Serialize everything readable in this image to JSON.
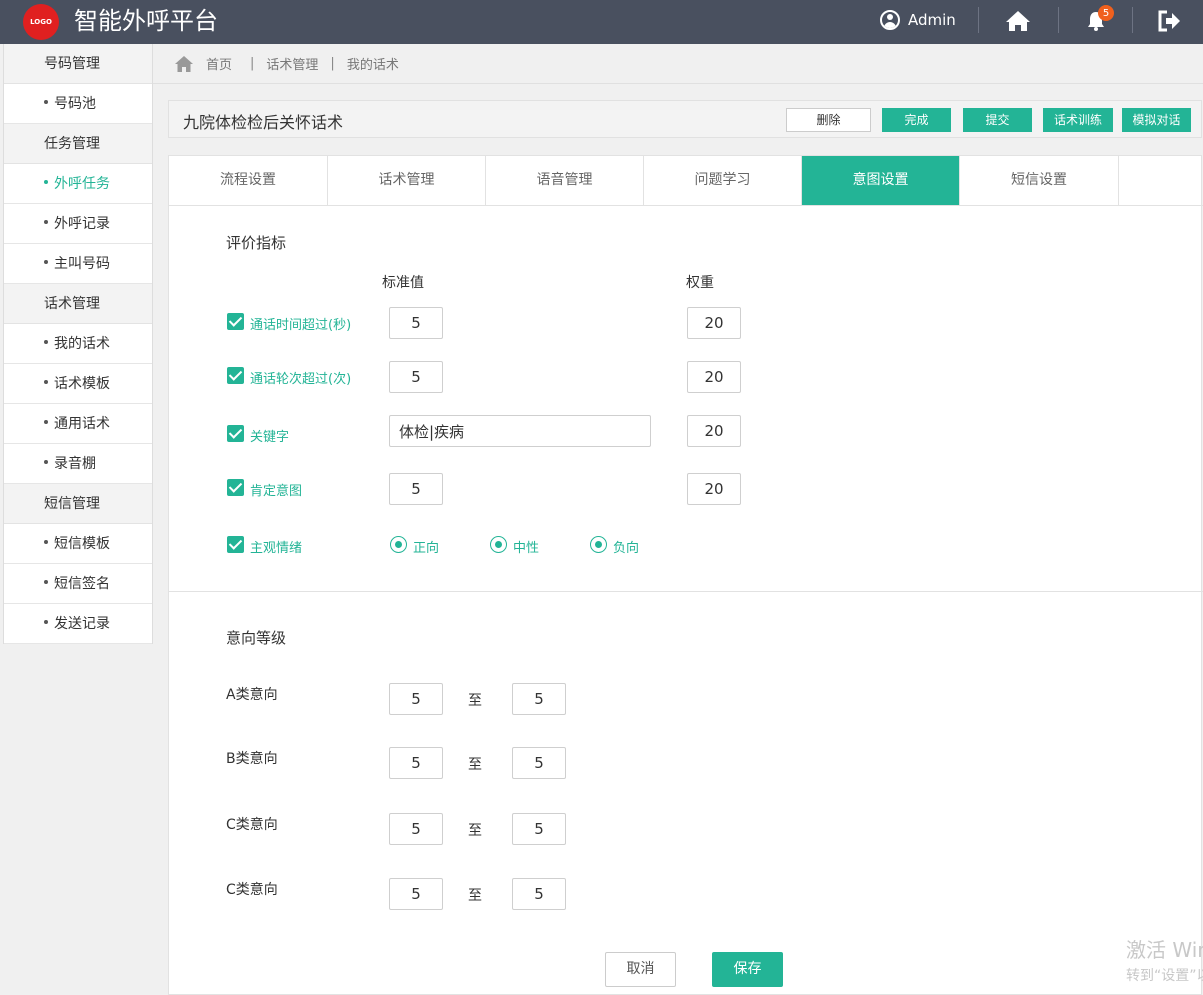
{
  "header": {
    "logo_text": "LOGO",
    "app_title": "智能外呼平台",
    "user_name": "Admin",
    "notification_count": "5"
  },
  "sidebar": {
    "groups": [
      {
        "label": "号码管理",
        "items": [
          {
            "label": "号码池"
          }
        ]
      },
      {
        "label": "任务管理",
        "items": [
          {
            "label": "外呼任务",
            "active": true
          },
          {
            "label": "外呼记录"
          },
          {
            "label": "主叫号码"
          }
        ]
      },
      {
        "label": "话术管理",
        "items": [
          {
            "label": "我的话术"
          },
          {
            "label": "话术模板"
          },
          {
            "label": "通用话术"
          },
          {
            "label": "录音棚"
          }
        ]
      },
      {
        "label": "短信管理",
        "items": [
          {
            "label": "短信模板"
          },
          {
            "label": "短信签名"
          },
          {
            "label": "发送记录"
          }
        ]
      }
    ]
  },
  "breadcrumb": {
    "home": "首页",
    "level1": "话术管理",
    "level2": "我的话术"
  },
  "titlebar": {
    "title": "九院体检检后关怀话术",
    "buttons": [
      "删除",
      "完成",
      "提交",
      "话术训练",
      "模拟对话"
    ]
  },
  "tabs": [
    "流程设置",
    "话术管理",
    "语音管理",
    "问题学习",
    "意图设置",
    "短信设置"
  ],
  "active_tab": "意图设置",
  "evaluation": {
    "title": "评价指标",
    "col_standard": "标准值",
    "col_weight": "权重",
    "rows": [
      {
        "label": "通话时间超过(秒)",
        "checked": true,
        "standard": "5",
        "weight": "20"
      },
      {
        "label": "通话轮次超过(次)",
        "checked": true,
        "standard": "5",
        "weight": "20"
      },
      {
        "label": "关键字",
        "checked": true,
        "standard": "体检|疾病",
        "weight": "20"
      },
      {
        "label": "肯定意图",
        "checked": true,
        "standard": "5",
        "weight": "20"
      }
    ],
    "emotion": {
      "label": "主观情绪",
      "checked": true,
      "options": [
        "正向",
        "中性",
        "负向"
      ]
    }
  },
  "intent_level": {
    "title": "意向等级",
    "to_label": "至",
    "rows": [
      {
        "label": "A类意向",
        "from": "5",
        "to": "5"
      },
      {
        "label": "B类意向",
        "from": "5",
        "to": "5"
      },
      {
        "label": "C类意向",
        "from": "5",
        "to": "5"
      },
      {
        "label": "C类意向",
        "from": "5",
        "to": "5"
      }
    ]
  },
  "actions": {
    "cancel": "取消",
    "save": "保存"
  },
  "watermark": {
    "line1": "激活 Windows",
    "line2": "转到“设置”以激活 Windows。"
  },
  "colors": {
    "accent": "#23b496",
    "header_bg": "#49505f",
    "badge": "#f0601d",
    "logo": "#e02020"
  }
}
